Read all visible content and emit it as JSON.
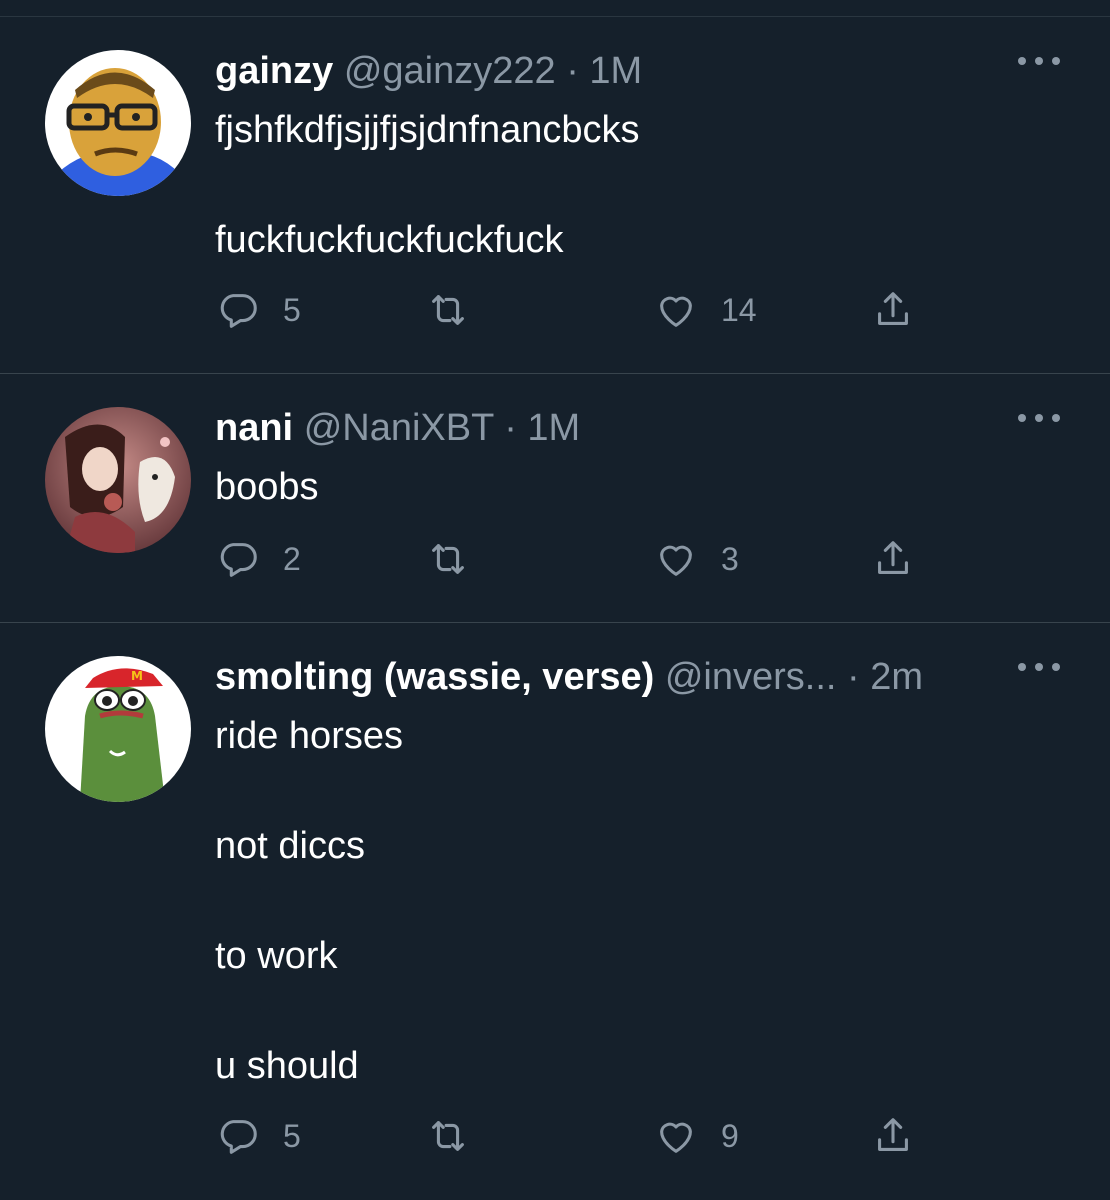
{
  "tweets": [
    {
      "name": "gainzy",
      "handle": "@gainzy222",
      "separator": "·",
      "time": "1M",
      "lines": [
        "fjshfkdfjsjjfjsjdnfnancbcks",
        "",
        "fuckfuckfuckfuckfuck"
      ],
      "replies": "5",
      "retweets": "",
      "likes": "14",
      "avatar_icon": "cartoon-face-glasses-avatar"
    },
    {
      "name": "nani",
      "handle": "@NaniXBT",
      "separator": "·",
      "time": "1M",
      "lines": [
        "boobs"
      ],
      "replies": "2",
      "retweets": "",
      "likes": "3",
      "avatar_icon": "anime-girl-avatar"
    },
    {
      "name": "smolting (wassie, verse)",
      "handle": "@invers...",
      "separator": "·",
      "time": "2m",
      "lines": [
        "ride horses",
        "",
        "not diccs",
        "",
        "to work",
        "",
        "u should"
      ],
      "replies": "5",
      "retweets": "",
      "likes": "9",
      "avatar_icon": "frog-with-cap-avatar"
    }
  ],
  "icons": {
    "reply": "reply-bubble-icon",
    "retweet": "retweet-arrows-icon",
    "like": "heart-icon",
    "share": "share-upload-icon",
    "more": "more-dots-icon"
  },
  "colors": {
    "background": "#15202b",
    "divider": "#38444d",
    "secondary_text": "#8b98a5",
    "primary_text": "#ffffff"
  }
}
